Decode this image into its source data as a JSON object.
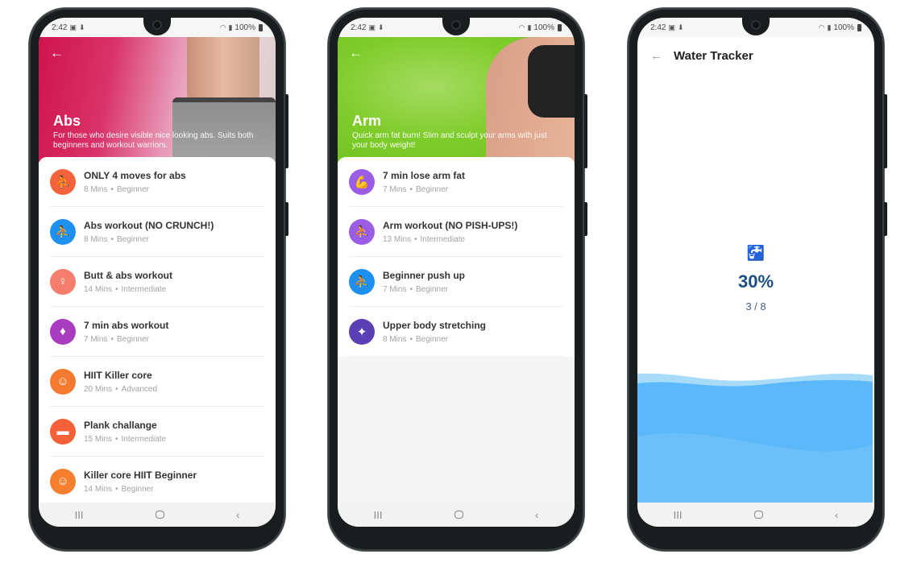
{
  "status_bar": {
    "time": "2:42",
    "battery": "100%",
    "left_icons": [
      "gallery-icon",
      "download-icon"
    ],
    "right_icons": [
      "wifi-icon",
      "signal-icon",
      "battery-icon"
    ]
  },
  "nav_bar": {
    "recents": "III",
    "back": "‹"
  },
  "screens": [
    {
      "hero": {
        "title": "Abs",
        "description": "For those who desire visible nice looking abs. Suits both beginners and workout warriors.",
        "back": "←"
      },
      "workouts": [
        {
          "name": "ONLY 4 moves for abs",
          "duration": "8 Mins",
          "level": "Beginner",
          "icon": "situp-icon",
          "glyph": "⛹",
          "color": "#f4623a"
        },
        {
          "name": "Abs workout (NO CRUNCH!)",
          "duration": "8 Mins",
          "level": "Beginner",
          "icon": "abs-exercise-icon",
          "glyph": "⛹",
          "color": "#1e90f0"
        },
        {
          "name": "Butt & abs workout",
          "duration": "14 Mins",
          "level": "Intermediate",
          "icon": "body-outline-icon",
          "glyph": "♀",
          "color": "#f47d6c"
        },
        {
          "name": "7 min abs workout",
          "duration": "7 Mins",
          "level": "Beginner",
          "icon": "torso-icon",
          "glyph": "♦",
          "color": "#a93bbf"
        },
        {
          "name": "HIIT Killer core",
          "duration": "20 Mins",
          "level": "Advanced",
          "icon": "athlete-icon",
          "glyph": "☺",
          "color": "#f47a2f"
        },
        {
          "name": "Plank challange",
          "duration": "15 Mins",
          "level": "Intermediate",
          "icon": "plank-icon",
          "glyph": "▬",
          "color": "#f46038"
        },
        {
          "name": "Killer core HIIT Beginner",
          "duration": "14 Mins",
          "level": "Beginner",
          "icon": "athlete-icon",
          "glyph": "☺",
          "color": "#f4802f"
        }
      ]
    },
    {
      "hero": {
        "title": "Arm",
        "description": "Quick arm fat burn! Slim and sculpt your arms with just your body weight!",
        "back": "←"
      },
      "workouts": [
        {
          "name": "7 min lose arm fat",
          "duration": "7 Mins",
          "level": "Beginner",
          "icon": "bicep-icon",
          "glyph": "💪",
          "color": "#9b5de5"
        },
        {
          "name": "Arm workout (NO PISH-UPS!)",
          "duration": "13 Mins",
          "level": "Intermediate",
          "icon": "pushup-icon",
          "glyph": "⛹",
          "color": "#9b5de5"
        },
        {
          "name": "Beginner push up",
          "duration": "7 Mins",
          "level": "Beginner",
          "icon": "pushup-icon",
          "glyph": "⛹",
          "color": "#1e90f0"
        },
        {
          "name": "Upper body stretching",
          "duration": "8 Mins",
          "level": "Beginner",
          "icon": "stretching-icon",
          "glyph": "✦",
          "color": "#5b3fb5"
        }
      ]
    },
    {
      "header": {
        "title": "Water Tracker",
        "back": "←"
      },
      "tracker": {
        "icon": "faucet-icon",
        "glyph": "🚰",
        "percent": "30%",
        "count": "3 / 8",
        "progress_fraction": 0.3
      }
    }
  ],
  "colors": {
    "water_light": "#9fd6f7",
    "water_main": "#5cb8f8",
    "percent_text": "#1d4f82"
  }
}
